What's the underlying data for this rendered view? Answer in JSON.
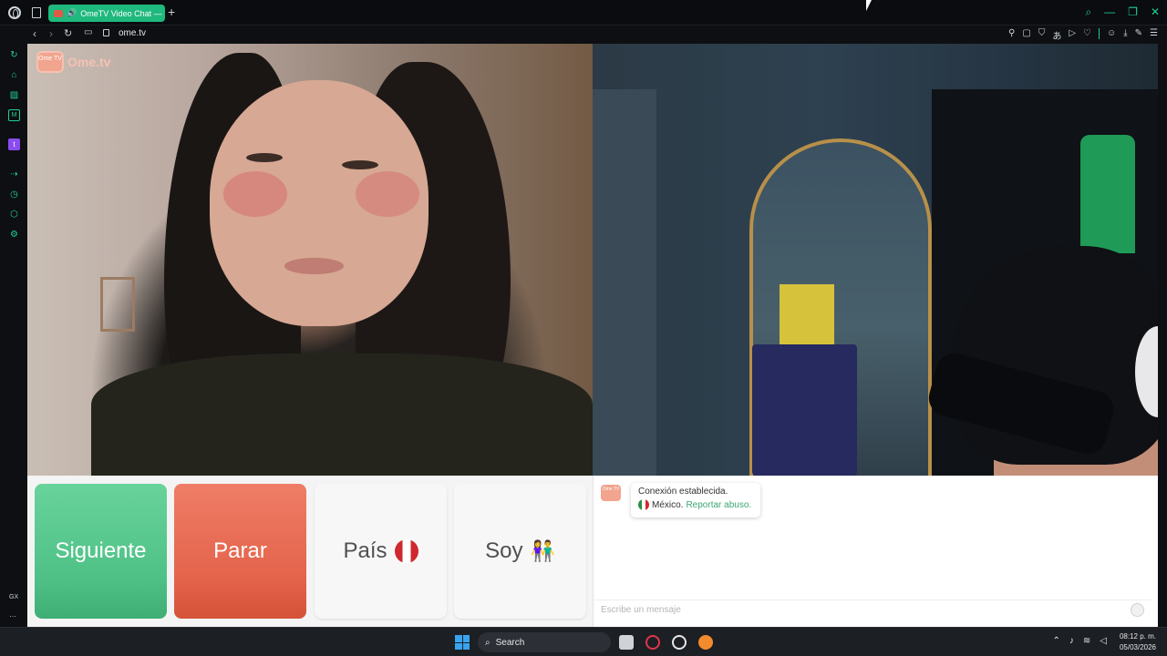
{
  "browser": {
    "tab_title": "OmeTV Video Chat — ",
    "new_tab_symbol": "+",
    "url": "ome.tv"
  },
  "site": {
    "logo_badge_text": "Ome TV",
    "logo_text": "Ome.tv"
  },
  "controls": {
    "next_label": "Siguiente",
    "stop_label": "Parar",
    "country_label": "País",
    "gender_label": "Soy"
  },
  "chat": {
    "badge_text": "Ome TV",
    "status_line": "Conexión establecida.",
    "country_name": "México.",
    "report_link": "Reportar abuso.",
    "input_placeholder": "Escribe un mensaje"
  },
  "taskbar": {
    "search_label": "Search",
    "time": "08:12 p. m.",
    "date": "05/03/2026"
  },
  "colors": {
    "accent_green": "#1fb87d",
    "next_button": "#4fc186",
    "stop_button": "#e4634b"
  }
}
